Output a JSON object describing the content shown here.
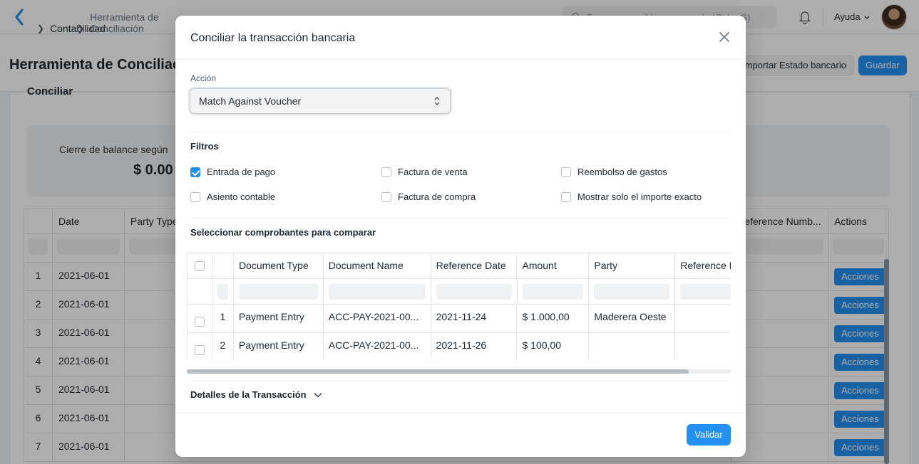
{
  "navbar": {
    "breadcrumbs": [
      "Contabilidad",
      "Herramienta de Conciliación Bancaria"
    ],
    "search_placeholder": "Buscar o escribir un comando (Ctrl + G)",
    "help_label": "Ayuda"
  },
  "page": {
    "title": "Herramienta de Conciliación Bancaria",
    "import_label": "Importar Estado bancario",
    "save_label": "Guardar",
    "card_title": "Conciliar",
    "summary_label": "Cierre de balance según",
    "summary_value": "$ 0.00"
  },
  "bg_table": {
    "columns": [
      "Date",
      "Party Type",
      "Reference Numb...",
      "Actions"
    ],
    "rows": [
      {
        "num": "1",
        "date": "2021-06-01",
        "action": "Acciones"
      },
      {
        "num": "2",
        "date": "2021-06-01",
        "action": "Acciones"
      },
      {
        "num": "3",
        "date": "2021-06-01",
        "action": "Acciones"
      },
      {
        "num": "4",
        "date": "2021-06-01",
        "action": "Acciones"
      },
      {
        "num": "5",
        "date": "2021-06-01",
        "action": "Acciones"
      },
      {
        "num": "6",
        "date": "2021-06-01",
        "action": "Acciones"
      },
      {
        "num": "7",
        "date": "2021-06-01",
        "action": "Acciones"
      }
    ]
  },
  "modal": {
    "title": "Conciliar la transacción bancaria",
    "action_label": "Acción",
    "action_value": "Match Against Voucher",
    "filters_title": "Filtros",
    "filters": {
      "entrada_pago": {
        "label": "Entrada de pago",
        "checked": true
      },
      "factura_venta": {
        "label": "Factura de venta",
        "checked": false
      },
      "reembolso_gastos": {
        "label": "Reembolso de gastos",
        "checked": false
      },
      "asiento_contable": {
        "label": "Asiento contable",
        "checked": false
      },
      "factura_compra": {
        "label": "Factura de compra",
        "checked": false
      },
      "importe_exacto": {
        "label": "Mostrar solo el importe exacto",
        "checked": false
      }
    },
    "vouchers_title": "Seleccionar comprobantes para comparar",
    "grid": {
      "columns": [
        "Document Type",
        "Document Name",
        "Reference Date",
        "Amount",
        "Party",
        "Reference N"
      ],
      "rows": [
        {
          "num": "1",
          "doc_type": "Payment Entry",
          "doc_name": "ACC-PAY-2021-00...",
          "ref_date": "2021-11-24",
          "amount": "$ 1.000,00",
          "party": "Maderera Oeste",
          "ref_no": ""
        },
        {
          "num": "2",
          "doc_type": "Payment Entry",
          "doc_name": "ACC-PAY-2021-00...",
          "ref_date": "2021-11-26",
          "amount": "$ 100,00",
          "party": "",
          "ref_no": ""
        }
      ]
    },
    "details_label": "Detalles de la Transacción",
    "submit_label": "Validar"
  },
  "colors": {
    "accent": "#2490ef",
    "overlay": "rgba(0,0,0,0.32)"
  }
}
